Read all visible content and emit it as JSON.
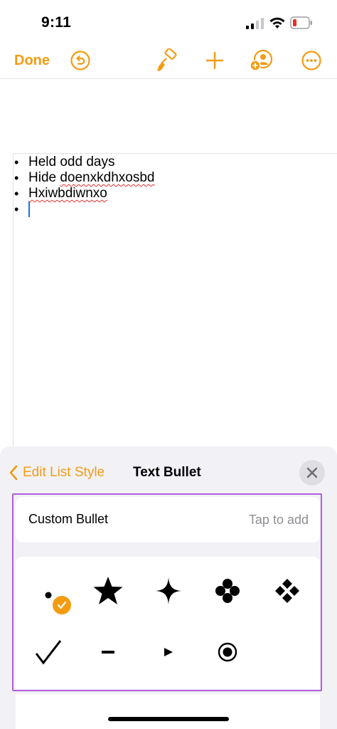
{
  "status_bar": {
    "time": "9:11"
  },
  "toolbar": {
    "done_label": "Done",
    "icons": [
      "undo-icon",
      "paintbrush-icon",
      "plus-icon",
      "collaborate-icon",
      "more-icon"
    ],
    "accent_color": "#f39c12"
  },
  "document": {
    "items": [
      "Held odd days",
      "Hide doenxkdhxosbd",
      "Hxiwbdiwnxo",
      ""
    ]
  },
  "panel": {
    "back_label": "Edit List Style",
    "title": "Text Bullet",
    "custom_bullet_label": "Custom Bullet",
    "custom_bullet_hint": "Tap to add",
    "bullets": [
      "dot",
      "star",
      "four-point-star",
      "clover",
      "diamond-cluster",
      "checkmark",
      "dash",
      "triangle",
      "target"
    ],
    "selected_bullet": "dot"
  }
}
